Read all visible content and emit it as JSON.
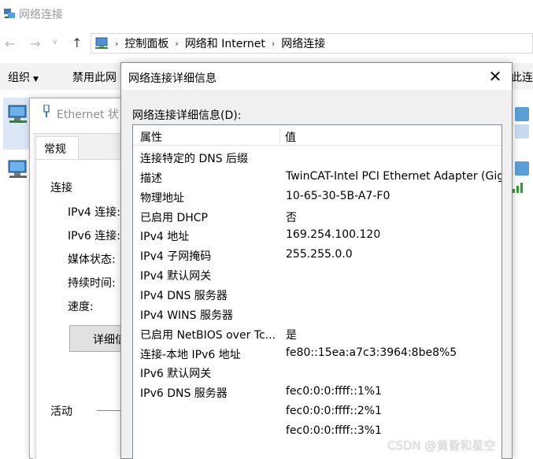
{
  "explorer": {
    "title": "网络连接",
    "breadcrumbs": [
      "控制面板",
      "网络和 Internet",
      "网络连接"
    ],
    "commands": {
      "organize": "组织",
      "disable": "禁用此网",
      "right_cut": "此连"
    }
  },
  "ethernet_status": {
    "title": "Ethernet 状",
    "tab_general": "常规",
    "section_connection": "连接",
    "ipv4_conn_label": "IPv4 连接:",
    "ipv6_conn_label": "IPv6 连接:",
    "media_state_label": "媒体状态:",
    "duration_label": "持续时间:",
    "speed_label": "速度:",
    "details_button": "详细信",
    "section_activity": "活动"
  },
  "details_dialog": {
    "title": "网络连接详细信息",
    "list_label": "网络连接详细信息(D):",
    "columns": {
      "property": "属性",
      "value": "值"
    },
    "rows": [
      {
        "property": "连接特定的 DNS 后缀",
        "value": ""
      },
      {
        "property": "描述",
        "value": "TwinCAT-Intel PCI Ethernet Adapter (Gig"
      },
      {
        "property": "物理地址",
        "value": "10-65-30-5B-A7-F0"
      },
      {
        "property": "已启用 DHCP",
        "value": "否"
      },
      {
        "property": "IPv4 地址",
        "value": "169.254.100.120"
      },
      {
        "property": "IPv4 子网掩码",
        "value": "255.255.0.0"
      },
      {
        "property": "IPv4 默认网关",
        "value": ""
      },
      {
        "property": "IPv4 DNS 服务器",
        "value": ""
      },
      {
        "property": "IPv4 WINS 服务器",
        "value": ""
      },
      {
        "property": "已启用 NetBIOS over Tc...",
        "value": "是"
      },
      {
        "property": "连接-本地 IPv6 地址",
        "value": "fe80::15ea:a7c3:3964:8be8%5"
      },
      {
        "property": "IPv6 默认网关",
        "value": ""
      },
      {
        "property": "IPv6 DNS 服务器",
        "value": "fec0:0:0:ffff::1%1"
      },
      {
        "property": "",
        "value": "fec0:0:0:ffff::2%1"
      },
      {
        "property": "",
        "value": "fec0:0:0:ffff::3%1"
      }
    ]
  },
  "watermark": "CSDN @黄昏和星空",
  "icons": {
    "close": "close-icon",
    "back": "back-arrow-icon",
    "forward": "forward-arrow-icon",
    "up": "up-arrow-icon",
    "network": "network-icon"
  }
}
